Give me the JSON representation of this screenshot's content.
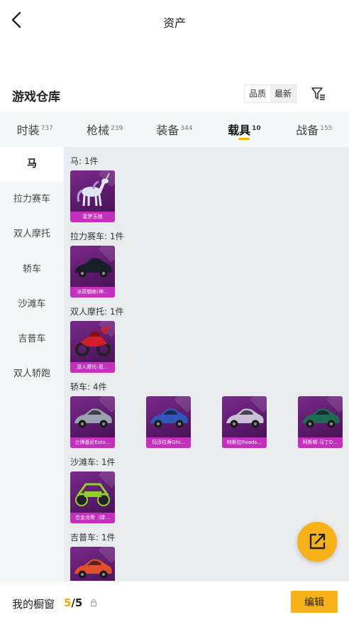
{
  "header": {
    "title": "资产"
  },
  "warehouse": {
    "title": "游戏仓库",
    "sort_quality": "品质",
    "sort_newest": "最新"
  },
  "tabs": [
    {
      "label": "时装",
      "count": "737"
    },
    {
      "label": "枪械",
      "count": "239"
    },
    {
      "label": "装备",
      "count": "344"
    },
    {
      "label": "载具",
      "count": "10"
    },
    {
      "label": "战备",
      "count": "155"
    }
  ],
  "sidebar": [
    "马",
    "拉力赛车",
    "双人摩托",
    "轿车",
    "沙滩车",
    "吉普车",
    "双人轿跑"
  ],
  "sections": [
    {
      "label": "马: 1件",
      "items": [
        {
          "name": "星梦玉驰",
          "icon": "unicorn-icon",
          "color": "#dfe6f2"
        }
      ]
    },
    {
      "label": "拉力赛车: 1件",
      "items": [
        {
          "name": "冰原御座(神…",
          "icon": "rally-car-icon",
          "color": "#1a1f2e"
        }
      ]
    },
    {
      "label": "双人摩托: 1件",
      "items": [
        {
          "name": "双人摩托-双…",
          "icon": "motorbike-icon",
          "color": "#d11f2a"
        }
      ]
    },
    {
      "label": "轿车: 4件",
      "items": [
        {
          "name": "兰博基尼Esto…",
          "icon": "car-icon",
          "color": "#9aa3ad"
        },
        {
          "name": "玛莎拉蒂Ghi…",
          "icon": "car-icon",
          "color": "#2f58b8"
        },
        {
          "name": "特斯拉Roads…",
          "icon": "car-icon",
          "color": "#c9bfd6"
        },
        {
          "name": "阿斯顿·马丁D…",
          "icon": "car-icon",
          "color": "#1f6a55"
        }
      ]
    },
    {
      "label": "沙滩车: 1件",
      "items": [
        {
          "name": "合金龙骨（绿…",
          "icon": "buggy-icon",
          "color": "#8fd12a"
        }
      ]
    },
    {
      "label": "吉普车: 1件",
      "items": [
        {
          "name": "",
          "icon": "car-icon",
          "color": "#e0502a"
        }
      ]
    }
  ],
  "showcase": {
    "label": "我的橱窗",
    "current": "5",
    "total": "/5",
    "edit_label": "编辑"
  },
  "colors": {
    "accent": "#f7b21a",
    "card_caption": "#c42fbd",
    "card_bg": "#6a1f7a"
  }
}
